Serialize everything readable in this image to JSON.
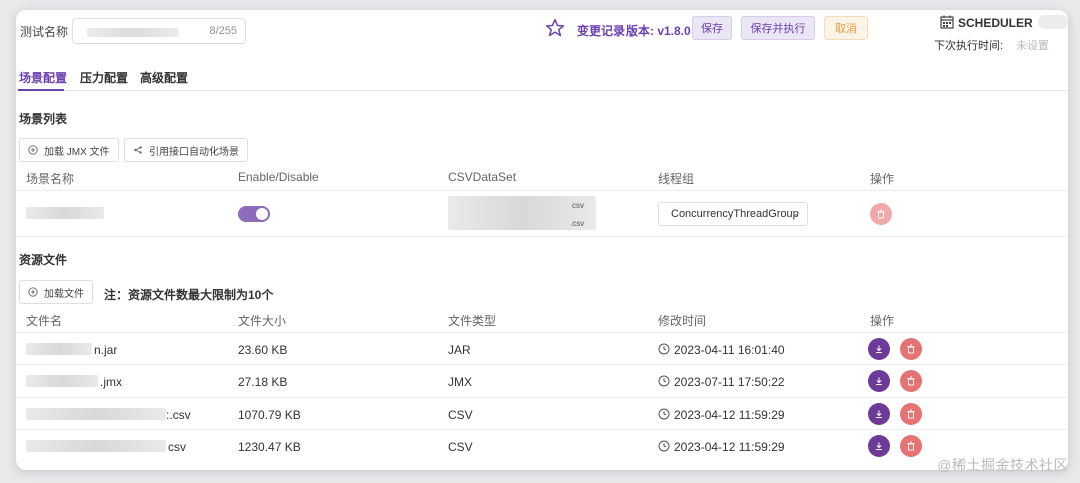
{
  "header": {
    "name_label": "测试名称",
    "name_counter": "8/255",
    "changelog": "变更记录",
    "version_label": "版本: v1.8.0",
    "save_button": "保存",
    "save_execute_button": "保存并执行",
    "cancel_button": "取消",
    "scheduler_title": "SCHEDULER",
    "next_exec_label": "下次执行时间:",
    "next_exec_value": "未设置"
  },
  "tabs": [
    {
      "label": "场景配置",
      "active": true
    },
    {
      "label": "压力配置",
      "active": false
    },
    {
      "label": "高级配置",
      "active": false
    }
  ],
  "scenario": {
    "section_title": "场景列表",
    "load_jmx_button": "加载 JMX 文件",
    "ref_api_button": "引用接口自动化场景",
    "columns": [
      "场景名称",
      "Enable/Disable",
      "CSVDataSet",
      "线程组",
      "操作"
    ],
    "rows": [
      {
        "enabled": true,
        "csv_tags": [
          "csv",
          ".csv"
        ],
        "thread_group": "ConcurrencyThreadGroup"
      }
    ]
  },
  "resources": {
    "section_title": "资源文件",
    "load_file_button": "加载文件",
    "note": "注：资源文件数最大限制为10个",
    "columns": [
      "文件名",
      "文件大小",
      "文件类型",
      "修改时间",
      "操作"
    ],
    "rows": [
      {
        "name_suffix": "n.jar",
        "size": "23.60 KB",
        "type": "JAR",
        "modified": "2023-04-11 16:01:40"
      },
      {
        "name_suffix": ".jmx",
        "size": "27.18 KB",
        "type": "JMX",
        "modified": "2023-07-11 17:50:22"
      },
      {
        "name_suffix": ":.csv",
        "size": "1070.79 KB",
        "type": "CSV",
        "modified": "2023-04-12 11:59:29"
      },
      {
        "name_suffix": "csv",
        "size": "1230.47 KB",
        "type": "CSV",
        "modified": "2023-04-12 11:59:29"
      }
    ]
  },
  "watermark": "@稀土掘金技术社区",
  "colors": {
    "accent": "#6a3fb0",
    "delete": "#e57373",
    "cancel": "#e6a23c"
  }
}
